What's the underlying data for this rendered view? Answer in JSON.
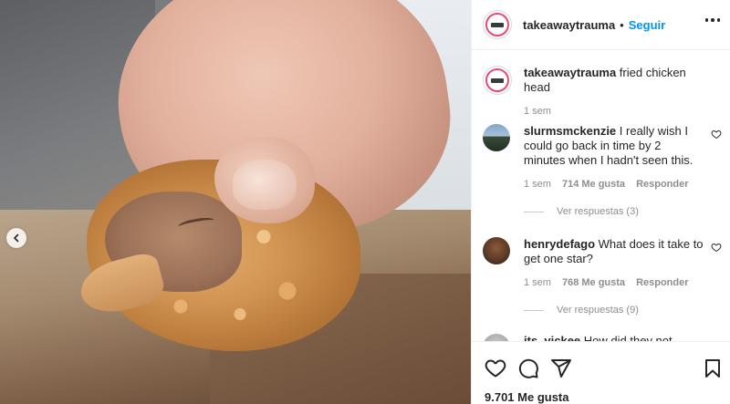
{
  "post": {
    "image_alt": "fried chicken head",
    "nav_prev_icon": "chevron-left-icon"
  },
  "header": {
    "username": "takeawaytrauma",
    "separator": "•",
    "follow_label": "Seguir",
    "more_icon": "more-horizontal-icon"
  },
  "caption": {
    "username": "takeawaytrauma",
    "text": "fried chicken head",
    "time": "1 sem"
  },
  "comments": [
    {
      "username": "slurmsmckenzie",
      "text": "I really wish I could go back in time by 2 minutes when I hadn't seen this.",
      "time": "1 sem",
      "likes": "714 Me gusta",
      "reply_label": "Responder",
      "view_replies": "Ver respuestas (3)"
    },
    {
      "username": "henrydefago",
      "text": "What does it take to get one star?",
      "time": "1 sem",
      "likes": "768 Me gusta",
      "reply_label": "Responder",
      "view_replies": "Ver respuestas (9)"
    },
    {
      "username": "its_vickee",
      "text": "How did they not notice"
    }
  ],
  "actions": {
    "like_icon": "heart-icon",
    "comment_icon": "comment-icon",
    "share_icon": "send-icon",
    "save_icon": "bookmark-icon",
    "likes_count": "9.701 Me gusta"
  },
  "colors": {
    "accent": "#0095f6",
    "text": "#262626",
    "muted": "#8e8e8e",
    "brand_ring": "#e84a74"
  }
}
